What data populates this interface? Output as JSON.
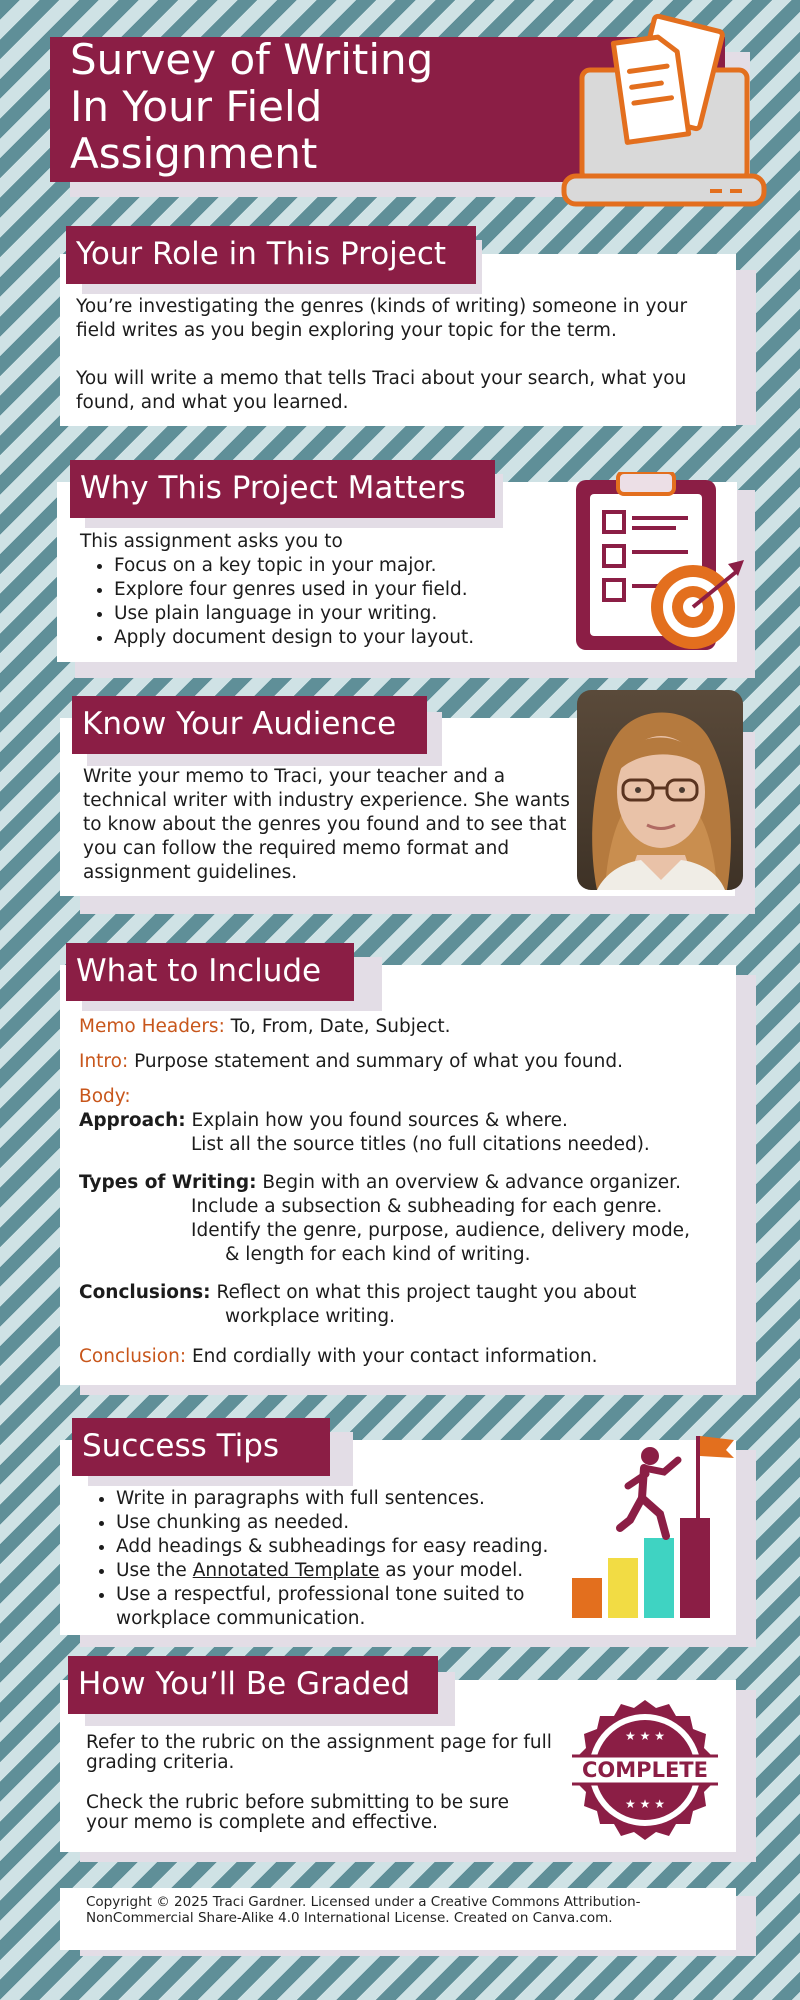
{
  "header": {
    "title_lines": [
      "Survey of Writing",
      "In Your Field",
      "Assignment"
    ]
  },
  "icons": {
    "laptop": "laptop-document-icon",
    "clipboard": "clipboard-target-icon",
    "photo": "teacher-portrait",
    "climber": "climber-bar-chart-icon",
    "badge": "complete-badge-icon"
  },
  "colors": {
    "maroon": "#8b1e45",
    "orange": "#c8561b",
    "teal_stripe": "#5f8f98"
  },
  "role": {
    "heading": "Your Role in This Project",
    "p1": "You’re investigating the genres (kinds of writing) someone in your field writes as you begin exploring your topic for the term.",
    "p2": "You will write a memo that tells Traci about your search, what you found, and what you learned."
  },
  "why": {
    "heading": "Why This Project  Matters",
    "intro": "This assignment asks you to",
    "items": [
      "Focus on a key topic in your major.",
      "Explore four genres used in your field.",
      "Use plain language in your writing.",
      "Apply document design to your layout."
    ]
  },
  "audience": {
    "heading": "Know Your Audience",
    "text": "Write your memo to Traci, your teacher and a technical writer with industry experience. She wants to know about the genres you found and to see that you can follow the required memo format and assignment guidelines."
  },
  "include": {
    "heading": "What to Include",
    "memo_label": "Memo Headers:",
    "memo_text": " To, From, Date, Subject.",
    "intro_label": "Intro:",
    "intro_text": " Purpose statement and summary of what you found.",
    "body_label": "Body:",
    "approach_label": "Approach:",
    "approach_l1": " Explain how you found sources & where.",
    "approach_l2": "List all the source titles (no full citations needed).",
    "types_label": "Types of Writing:",
    "types_l1": " Begin with an overview & advance organizer.",
    "types_l2": "Include a subsection & subheading for each genre.",
    "types_l3": "Identify the genre, purpose, audience, delivery mode,",
    "types_l4": "& length for each kind of writing.",
    "conc_label": "Conclusions:",
    "conc_l1": " Reflect on what this project taught you about",
    "conc_l2": "workplace writing.",
    "conclusion_label": "Conclusion:",
    "conclusion_text": " End cordially with your contact information."
  },
  "tips": {
    "heading": "Success Tips",
    "item1": "Write in paragraphs with full sentences.",
    "item2": "Use chunking as needed.",
    "item3": "Add headings & subheadings for easy reading.",
    "item4_pre": "Use the ",
    "item4_link": "Annotated Template",
    "item4_post": " as your model.",
    "item5": "Use a respectful, professional tone suited to workplace communication."
  },
  "graded": {
    "heading": "How You’ll Be Graded",
    "p1": "Refer to the rubric on the  assignment page for full grading criteria.",
    "p2": "Check the rubric before submitting to be sure your memo is complete and effective.",
    "badge_text": "COMPLETE"
  },
  "footer": {
    "text": "Copyright © 2025 Traci Gardner. Licensed under a Creative Commons Attribution-NonCommercial Share-Alike 4.0 International License. Created on Canva.com."
  }
}
